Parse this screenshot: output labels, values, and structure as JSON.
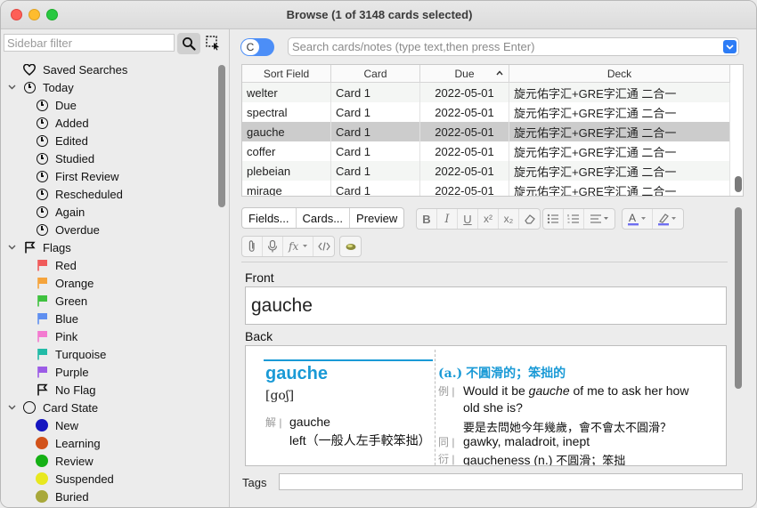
{
  "window": {
    "title": "Browse (1 of 3148 cards selected)"
  },
  "sidebar": {
    "filter_placeholder": "Sidebar filter",
    "items": [
      {
        "label": "Saved Searches",
        "icon": "heart-icon",
        "indent": 0,
        "chevron": ""
      },
      {
        "label": "Today",
        "icon": "clock-icon",
        "indent": 0,
        "chevron": "down"
      },
      {
        "label": "Due",
        "icon": "clock-icon",
        "indent": 1
      },
      {
        "label": "Added",
        "icon": "clock-icon",
        "indent": 1
      },
      {
        "label": "Edited",
        "icon": "clock-icon",
        "indent": 1
      },
      {
        "label": "Studied",
        "icon": "clock-icon",
        "indent": 1
      },
      {
        "label": "First Review",
        "icon": "clock-icon",
        "indent": 1
      },
      {
        "label": "Rescheduled",
        "icon": "clock-icon",
        "indent": 1
      },
      {
        "label": "Again",
        "icon": "clock-icon",
        "indent": 1
      },
      {
        "label": "Overdue",
        "icon": "clock-icon",
        "indent": 1
      },
      {
        "label": "Flags",
        "icon": "flag-outline-icon",
        "indent": 0,
        "chevron": "down"
      },
      {
        "label": "Red",
        "icon": "flag-icon",
        "color": "#f05b5b",
        "indent": 1
      },
      {
        "label": "Orange",
        "icon": "flag-icon",
        "color": "#f5a43c",
        "indent": 1
      },
      {
        "label": "Green",
        "icon": "flag-icon",
        "color": "#3fc13f",
        "indent": 1
      },
      {
        "label": "Blue",
        "icon": "flag-icon",
        "color": "#5f8ff0",
        "indent": 1
      },
      {
        "label": "Pink",
        "icon": "flag-icon",
        "color": "#f37ad0",
        "indent": 1
      },
      {
        "label": "Turquoise",
        "icon": "flag-icon",
        "color": "#22bba7",
        "indent": 1
      },
      {
        "label": "Purple",
        "icon": "flag-icon",
        "color": "#9c5ce6",
        "indent": 1
      },
      {
        "label": "No Flag",
        "icon": "flag-outline-icon",
        "indent": 1
      },
      {
        "label": "Card State",
        "icon": "circle-icon",
        "indent": 0,
        "chevron": "down"
      },
      {
        "label": "New",
        "icon": "dot-icon",
        "color": "#1515c0",
        "indent": 1
      },
      {
        "label": "Learning",
        "icon": "dot-icon",
        "color": "#d2521a",
        "indent": 1
      },
      {
        "label": "Review",
        "icon": "dot-icon",
        "color": "#15b015",
        "indent": 1
      },
      {
        "label": "Suspended",
        "icon": "dot-icon",
        "color": "#e8e81f",
        "indent": 1
      },
      {
        "label": "Buried",
        "icon": "dot-icon",
        "color": "#a8a83a",
        "indent": 1
      }
    ]
  },
  "toggle": {
    "label": "C"
  },
  "search": {
    "placeholder": "Search cards/notes (type text,then press Enter)"
  },
  "table": {
    "columns": [
      "Sort Field",
      "Card",
      "Due",
      "Deck"
    ],
    "rows": [
      {
        "sort": "welter",
        "card": "Card 1",
        "due": "2022-05-01",
        "deck": "旋元佑字汇+GRE字汇通 二合一"
      },
      {
        "sort": "spectral",
        "card": "Card 1",
        "due": "2022-05-01",
        "deck": "旋元佑字汇+GRE字汇通 二合一"
      },
      {
        "sort": "gauche",
        "card": "Card 1",
        "due": "2022-05-01",
        "deck": "旋元佑字汇+GRE字汇通 二合一"
      },
      {
        "sort": "coffer",
        "card": "Card 1",
        "due": "2022-05-01",
        "deck": "旋元佑字汇+GRE字汇通 二合一"
      },
      {
        "sort": "plebeian",
        "card": "Card 1",
        "due": "2022-05-01",
        "deck": "旋元佑字汇+GRE字汇通 二合一"
      },
      {
        "sort": "mirage",
        "card": "Card 1",
        "due": "2022-05-01",
        "deck": "旋元佑字汇+GRE字汇通 二合一"
      }
    ],
    "selected_index": 2
  },
  "editor": {
    "fields_btn": "Fields...",
    "cards_btn": "Cards...",
    "preview_btn": "Preview",
    "front_label": "Front",
    "front_value": "gauche",
    "back_label": "Back",
    "tags_label": "Tags",
    "back": {
      "word": "gauche",
      "ipa": "[goʃ]",
      "jie_key": "解",
      "jie_1": "gauche",
      "jie_2": "left（一般人左手較笨拙）",
      "pos": "(a.)",
      "meaning": "不圓滑的；笨拙的",
      "li_key": "例",
      "ex_a": "Would it be ",
      "ex_em": "gauche",
      "ex_b": " of me to ask her how",
      "ex_2": "old she is?",
      "ex_zh": "要是去問她今年幾歲，會不會太不圓滑？",
      "tong_key": "同",
      "syn": "gawky, maladroit, inept",
      "yan_key": "衍",
      "der": "gaucheness (n.) ",
      "der_zh": "不圓滑；笨拙"
    }
  }
}
